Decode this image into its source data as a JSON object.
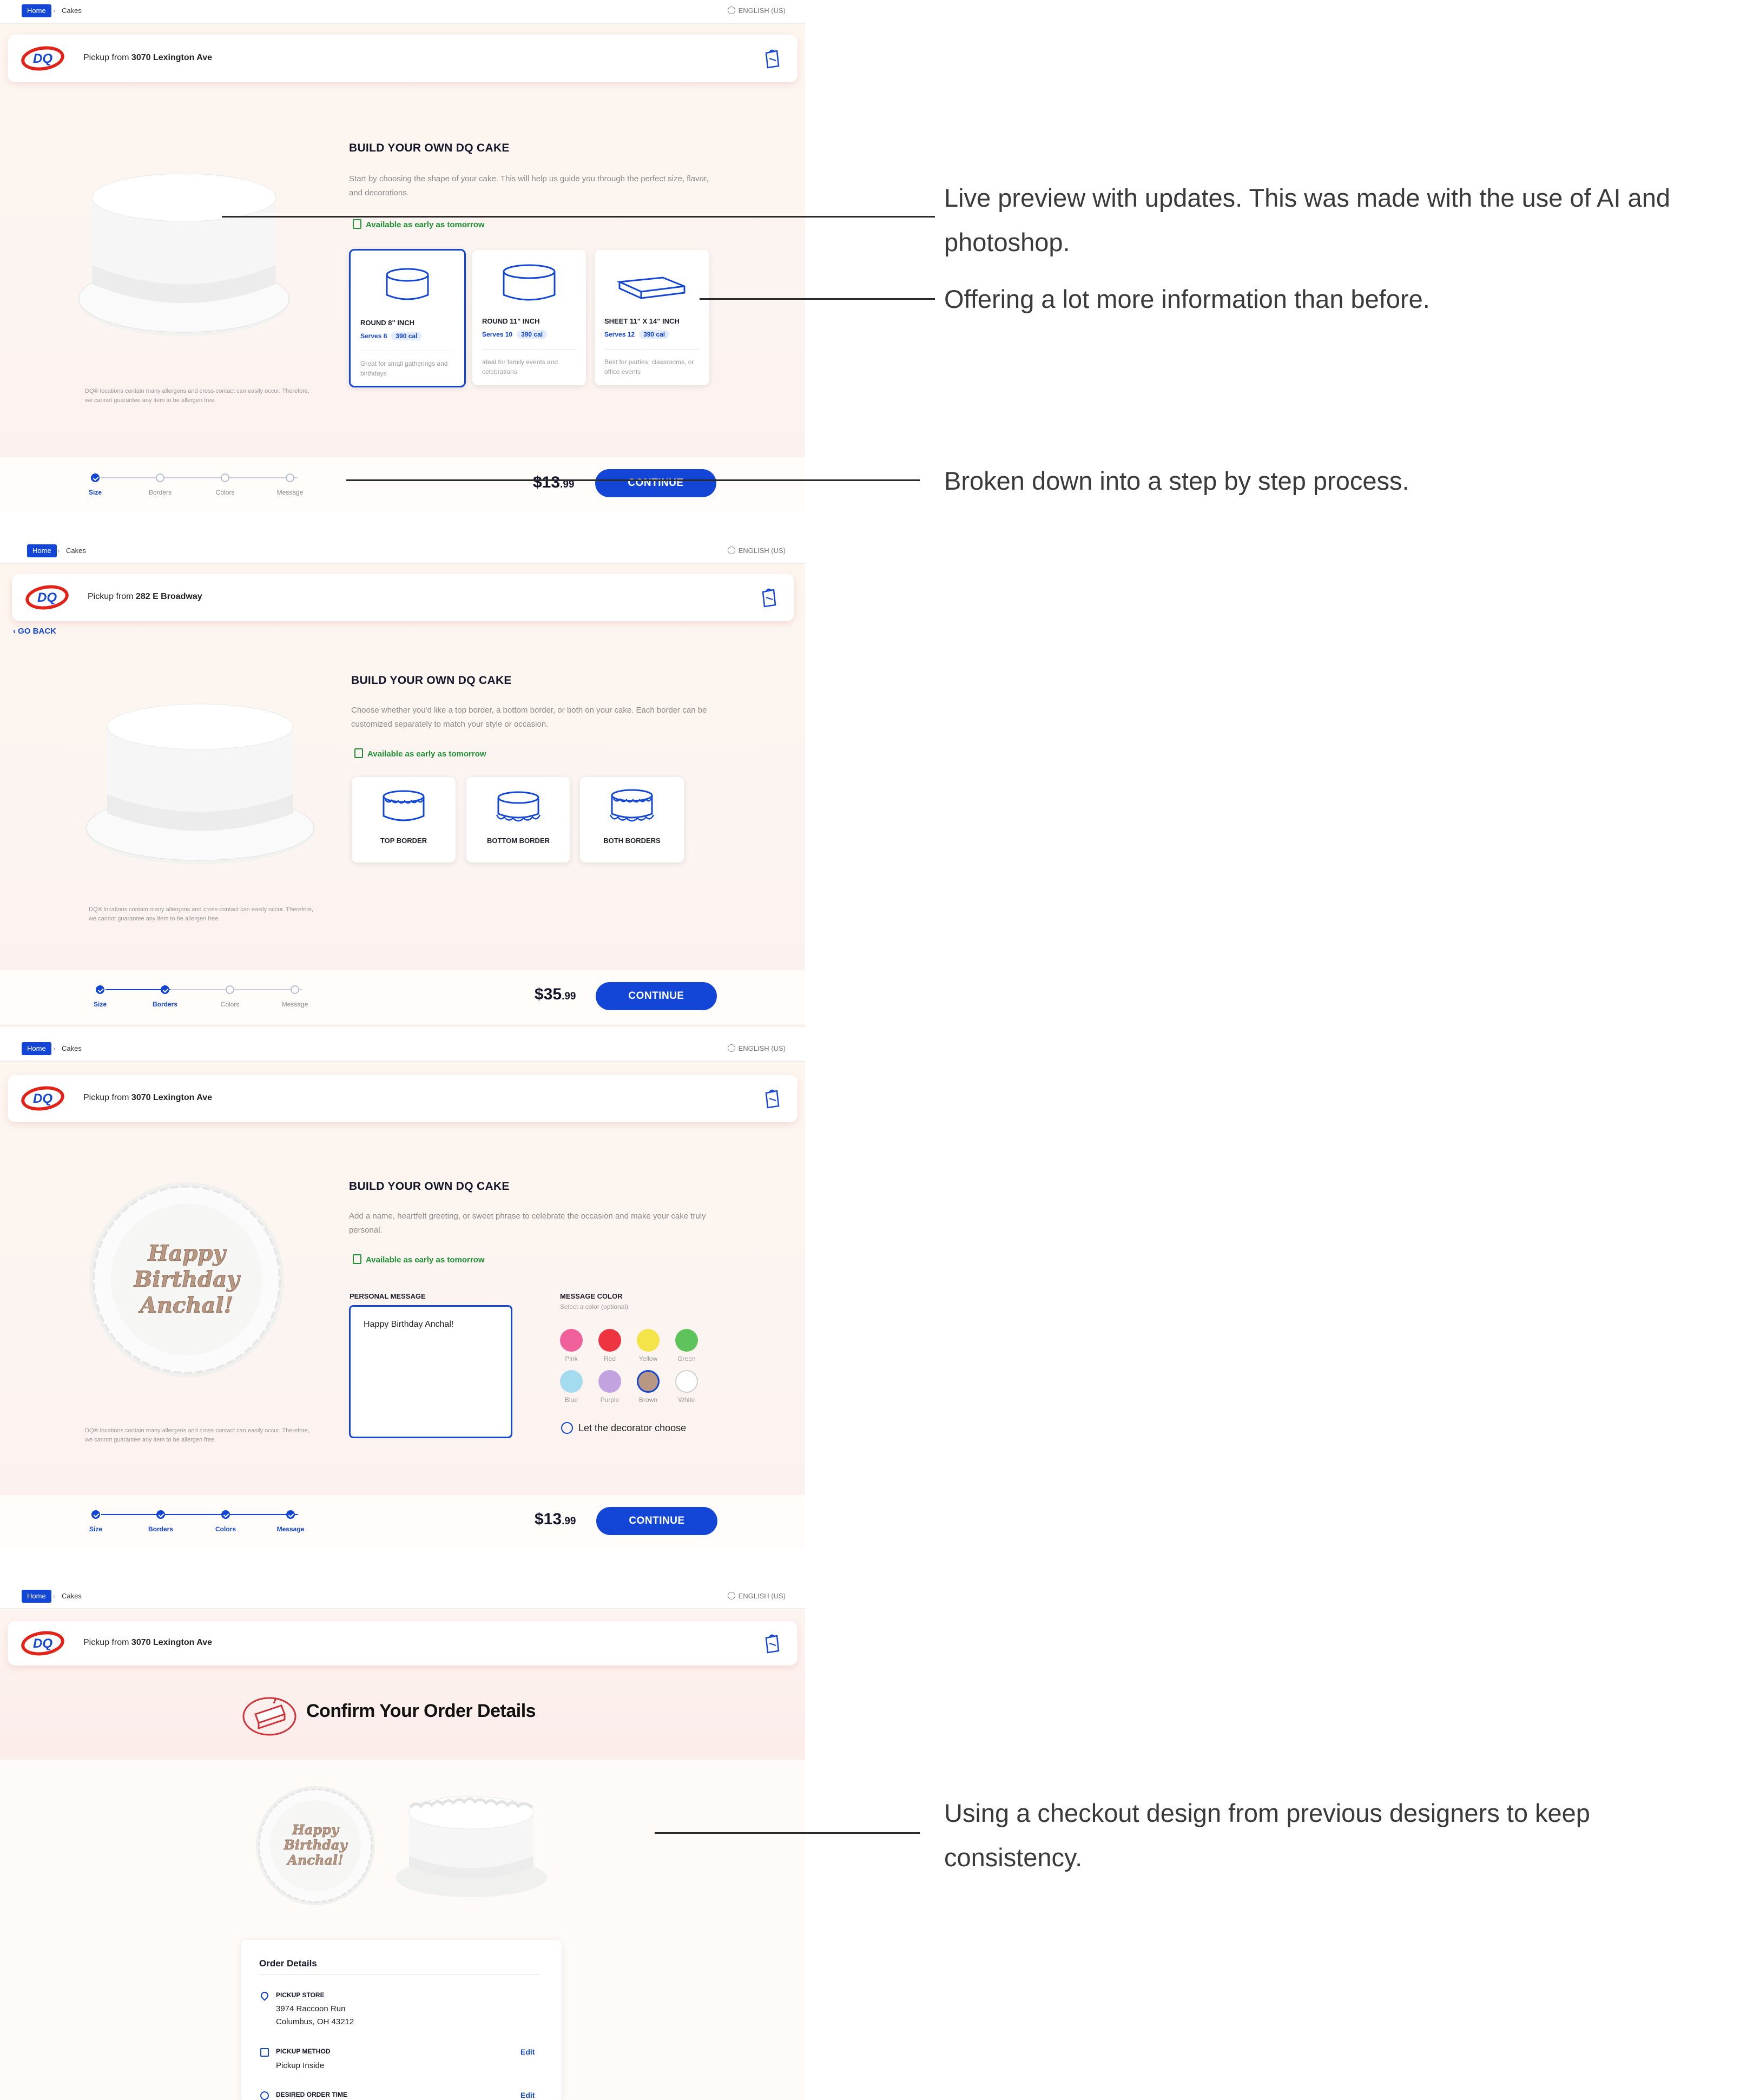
{
  "common": {
    "home": "Home",
    "cakes": "Cakes",
    "lang": "ENGLISH (US)",
    "pickup_prefix": "Pickup from",
    "build_title": "BUILD YOUR OWN DQ CAKE",
    "available": "Available as early as tomorrow",
    "allergen": "DQ® locations contain many allergens and cross-contact can easily occur. Therefore, we cannot guarantee any item to be allergen free.",
    "continue": "CONTINUE",
    "steps": [
      "Size",
      "Borders",
      "Colors",
      "Message"
    ],
    "dq_logo_text": "DQ",
    "go_back": "GO BACK"
  },
  "screen1": {
    "store": "3070 Lexington Ave",
    "desc": "Start by choosing the shape of your cake. This will help us guide you through the perfect size, flavor, and decorations.",
    "cards": [
      {
        "title": "ROUND 8\" INCH",
        "serves": "Serves 8",
        "cal": "390 cal",
        "desc": "Great for small gatherings and birthdays"
      },
      {
        "title": "ROUND 11\" INCH",
        "serves": "Serves 10",
        "cal": "390 cal",
        "desc": "Ideal for family events and celebrations"
      },
      {
        "title": "SHEET 11\" X 14\" INCH",
        "serves": "Serves 12",
        "cal": "390 cal",
        "desc": "Best for parties, classrooms, or office events"
      }
    ],
    "price_main": "$13",
    "price_cents": ".99"
  },
  "screen2": {
    "store": "282 E Broadway",
    "desc": "Choose whether you'd like a top border, a bottom border, or both on your cake. Each border can be customized separately to match your style or occasion.",
    "cards": [
      "TOP BORDER",
      "BOTTOM BORDER",
      "BOTH BORDERS"
    ],
    "price_main": "$35",
    "price_cents": ".99"
  },
  "screen3": {
    "store": "3070 Lexington Ave",
    "desc": "Add a name, heartfelt greeting, or sweet phrase to celebrate the occasion and make your cake truly personal.",
    "personal_message_label": "PERSONAL MESSAGE",
    "message_value": "Happy Birthday Anchal!",
    "color_label": "MESSAGE COLOR",
    "color_sub": "Select a color (optional)",
    "colors": [
      {
        "name": "Pink",
        "hex": "#f0609a"
      },
      {
        "name": "Red",
        "hex": "#ee3440"
      },
      {
        "name": "Yellow",
        "hex": "#f5e34a"
      },
      {
        "name": "Green",
        "hex": "#5dc35a"
      },
      {
        "name": "Blue",
        "hex": "#a4dbee"
      },
      {
        "name": "Purple",
        "hex": "#c2a2df"
      },
      {
        "name": "Brown",
        "hex": "#b89883"
      },
      {
        "name": "White",
        "hex": "#ffffff"
      }
    ],
    "decorator": "Let the decorator choose",
    "cake_text": [
      "Happy",
      "Birthday",
      "Anchal!"
    ],
    "price_main": "$13",
    "price_cents": ".99"
  },
  "screen4": {
    "store": "3070 Lexington Ave",
    "confirm_title": "Confirm Your Order Details",
    "cake_text": [
      "Happy",
      "Birthday",
      "Anchal!"
    ],
    "order_details": "Order Details",
    "pickup_store_label": "PICKUP STORE",
    "pickup_store_addr1": "3974 Raccoon Run",
    "pickup_store_addr2": "Columbus, OH 43212",
    "pickup_method_label": "PICKUP METHOD",
    "pickup_method_value": "Pickup Inside",
    "desired_time_label": "DESIRED ORDER TIME",
    "edit": "Edit"
  },
  "annotations": {
    "a1": "Live preview with updates. This was made with the use of AI and photoshop.",
    "a2": "Offering a lot more information than before.",
    "a3": "Broken down into a step by step process.",
    "a4": "Using a checkout design from previous designers to keep consistency."
  }
}
